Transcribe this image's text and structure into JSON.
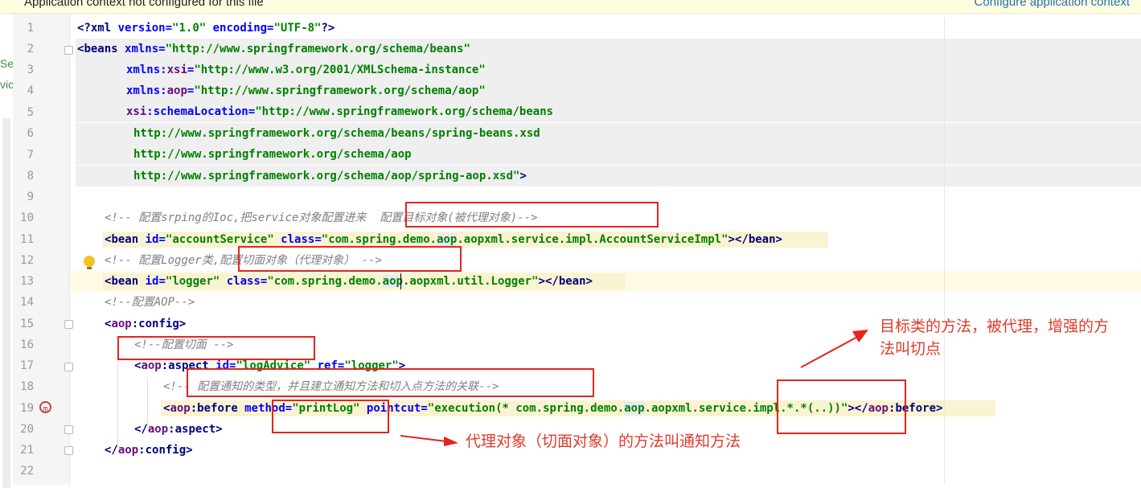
{
  "banner": {
    "message": "Application context not configured for this file",
    "link": "Configure application context"
  },
  "left_fragments": [
    "Ser",
    "vic"
  ],
  "line_numbers": [
    "1",
    "2",
    "3",
    "4",
    "5",
    "6",
    "7",
    "8",
    "9",
    "10",
    "11",
    "12",
    "13",
    "14",
    "15",
    "16",
    "17",
    "18",
    "19",
    "20",
    "21",
    "22"
  ],
  "code": {
    "l1": {
      "p1": "<?",
      "t": "xml",
      "a1": " version",
      "e1": "=",
      "v1": "\"1.0\"",
      "a2": " encoding",
      "e2": "=",
      "v2": "\"UTF-8\"",
      "p2": "?>"
    },
    "l2": {
      "lt": "<",
      "t": "beans",
      "a": " xmlns",
      "eq": "=",
      "v": "\"http://www.springframework.org/schema/beans\""
    },
    "l3": {
      "a": "xmlns",
      "c": ":",
      "ns": "xsi",
      "eq": "=",
      "v": "\"http://www.w3.org/2001/XMLSchema-instance\""
    },
    "l4": {
      "a": "xmlns",
      "c": ":",
      "ns": "aop",
      "eq": "=",
      "v": "\"http://www.springframework.org/schema/aop\""
    },
    "l5": {
      "ns": "xsi",
      "c": ":",
      "a": "schemaLocation",
      "eq": "=",
      "v": "\"http://www.springframework.org/schema/beans"
    },
    "l6": {
      "v": "http://www.springframework.org/schema/beans/spring-beans.xsd"
    },
    "l7": {
      "v": "http://www.springframework.org/schema/aop"
    },
    "l8": {
      "v": "http://www.springframework.org/schema/aop/spring-aop.xsd\"",
      "gt": ">"
    },
    "l10": {
      "cm": "<!-- 配置srping的Ioc,把service对象配置进来  配置目标对象(被代理对象)-->"
    },
    "l11": {
      "lt": "<",
      "t": "bean",
      "a1": " id",
      "e1": "=",
      "v1": "\"accountService\"",
      "a2": " class",
      "e2": "=",
      "v2a": "\"com.spring.demo.",
      "aop": "aop",
      "v2b": ".aopxml.service.impl.AccountServiceImpl\"",
      "gt": "></",
      "t2": "bean",
      "gt2": ">"
    },
    "l12": {
      "cm": "<!-- 配置Logger类,配置切面对象（代理对象） -->"
    },
    "l13": {
      "lt": "<",
      "t": "bean",
      "a1": " id",
      "e1": "=",
      "v1": "\"logger\"",
      "a2": " class",
      "e2": "=",
      "v2a": "\"com.spring.demo.",
      "aop": "aop",
      "v2b": ".aopxml.util.Logger\"",
      "gt": "></",
      "t2": "bean",
      "gt2": ">"
    },
    "l14": {
      "cm": "<!--配置AOP-->"
    },
    "l15": {
      "lt": "<",
      "ns": "aop",
      "c": ":",
      "t": "config",
      "gt": ">"
    },
    "l16": {
      "cm": "<!--配置切面 -->"
    },
    "l17": {
      "lt": "<",
      "ns": "aop",
      "c": ":",
      "t": "aspect",
      "a1": " id",
      "e1": "=",
      "v1": "\"logAdvice\"",
      "a2": " ref",
      "e2": "=",
      "v2": "\"logger\"",
      "gt": ">"
    },
    "l18": {
      "cm": "<!-- 配置通知的类型，并且建立通知方法和切入点方法的关联-->"
    },
    "l19": {
      "lt": "<",
      "ns": "aop",
      "c": ":",
      "t": "before",
      "a1": " method",
      "e1": "=",
      "v1": "\"printLog\"",
      "a2": " pointcut",
      "e2": "=",
      "v2a": "\"execution(* com.spring.demo.",
      "aop": "aop",
      "v2b": ".aopxml.service.impl.*.*(..))\"",
      "gt": "></",
      "ns2": "aop",
      "c2": ":",
      "t2": "before",
      "gt2": ">"
    },
    "l20": {
      "lt": "</",
      "ns": "aop",
      "c": ":",
      "t": "aspect",
      "gt": ">"
    },
    "l21": {
      "lt": "</",
      "ns": "aop",
      "c": ":",
      "t": "config",
      "gt": ">"
    }
  },
  "annotations": {
    "pointcut_note_line1": "目标类的方法，被代理，增强的方",
    "pointcut_note_line2": "法叫切点",
    "advice_note": "代理对象（切面对象）的方法叫通知方法"
  },
  "colors": {
    "annotation_red": "#e8231c",
    "xml_tag": "#000080",
    "xml_attr": "#0000ff",
    "xml_value": "#008000",
    "xml_namespace": "#660e7a",
    "comment": "#808080"
  }
}
